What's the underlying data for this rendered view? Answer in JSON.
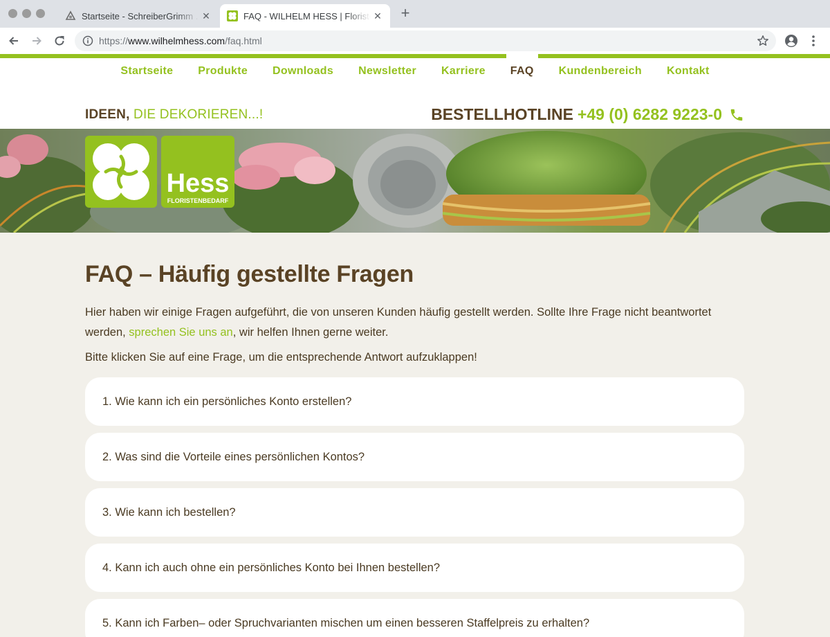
{
  "browser": {
    "tabs": [
      {
        "title": "Startseite - SchreiberGrimm . Werbeagentur",
        "active": false
      },
      {
        "title": "FAQ - WILHELM HESS | Floristenbedarf",
        "active": true
      }
    ],
    "url_scheme": "https://",
    "url_host": "www.wilhelmhess.com",
    "url_path": "/faq.html"
  },
  "nav": {
    "items": [
      "Startseite",
      "Produkte",
      "Downloads",
      "Newsletter",
      "Karriere",
      "FAQ",
      "Kundenbereich",
      "Kontakt"
    ],
    "active": "FAQ"
  },
  "header": {
    "tagline_strong": "IDEEN,",
    "tagline_rest": "DIE DEKORIEREN...!",
    "hotline_label": "BESTELLHOTLINE",
    "hotline_number": "+49 (0) 6282 9223-0"
  },
  "logo": {
    "brand": "Hess",
    "sub": "FLORISTENBEDARF"
  },
  "page": {
    "title": "FAQ – Häufig gestellte Fragen",
    "intro_1": "Hier haben wir einige Fragen aufgeführt, die von unseren Kunden häufig gestellt werden. Sollte Ihre Frage nicht beantwortet werden,",
    "intro_link": "sprechen Sie uns an",
    "intro_2": ", wir helfen Ihnen gerne weiter.",
    "hint": "Bitte klicken Sie auf eine Frage, um die entsprechende Antwort aufzuklappen!"
  },
  "faq": [
    "1. Wie kann ich ein persönliches Konto erstellen?",
    "2. Was sind die Vorteile eines persönlichen Kontos?",
    "3. Wie kann ich bestellen?",
    "4. Kann ich auch ohne ein persönliches Konto bei Ihnen bestellen?",
    "5. Kann ich Farben– oder Spruchvarianten mischen um einen besseren Staffelpreis zu erhalten?"
  ],
  "colors": {
    "brand_green": "#94c11f",
    "brand_brown": "#5a4325",
    "page_bg": "#f2f0ea"
  },
  "icons": [
    "back-arrow-icon",
    "forward-arrow-icon",
    "reload-icon",
    "info-icon",
    "star-icon",
    "profile-icon",
    "menu-icon",
    "phone-icon",
    "close-icon"
  ]
}
